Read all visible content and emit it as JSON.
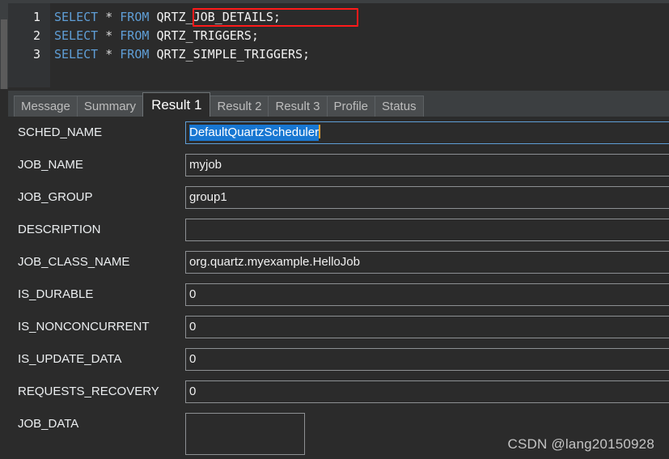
{
  "editor": {
    "lines": [
      {
        "number": "1",
        "keyword_select": "SELECT",
        "star": "*",
        "keyword_from": "FROM",
        "table": "QRTZ_JOB_DETAILS;",
        "highlighted": true
      },
      {
        "number": "2",
        "keyword_select": "SELECT",
        "star": "*",
        "keyword_from": "FROM",
        "table": "QRTZ_TRIGGERS;",
        "highlighted": false
      },
      {
        "number": "3",
        "keyword_select": "SELECT",
        "star": "*",
        "keyword_from": "FROM",
        "table": "QRTZ_SIMPLE_TRIGGERS;",
        "highlighted": false
      }
    ],
    "annotation_color": "#ff1a1a",
    "keyword_color": "#5f9ed6"
  },
  "tabs": [
    {
      "label": "Message",
      "active": false
    },
    {
      "label": "Summary",
      "active": false
    },
    {
      "label": "Result 1",
      "active": true
    },
    {
      "label": "Result 2",
      "active": false
    },
    {
      "label": "Result 3",
      "active": false
    },
    {
      "label": "Profile",
      "active": false
    },
    {
      "label": "Status",
      "active": false
    }
  ],
  "record": {
    "fields": [
      {
        "label": "SCHED_NAME",
        "value": "DefaultQuartzScheduler",
        "selected": true,
        "focused": true,
        "multiline": false
      },
      {
        "label": "JOB_NAME",
        "value": "myjob",
        "selected": false,
        "focused": false,
        "multiline": false
      },
      {
        "label": "JOB_GROUP",
        "value": "group1",
        "selected": false,
        "focused": false,
        "multiline": false
      },
      {
        "label": "DESCRIPTION",
        "value": "",
        "selected": false,
        "focused": false,
        "multiline": false
      },
      {
        "label": "JOB_CLASS_NAME",
        "value": "org.quartz.myexample.HelloJob",
        "selected": false,
        "focused": false,
        "multiline": false
      },
      {
        "label": "IS_DURABLE",
        "value": "0",
        "selected": false,
        "focused": false,
        "multiline": false
      },
      {
        "label": "IS_NONCONCURRENT",
        "value": "0",
        "selected": false,
        "focused": false,
        "multiline": false
      },
      {
        "label": "IS_UPDATE_DATA",
        "value": "0",
        "selected": false,
        "focused": false,
        "multiline": false
      },
      {
        "label": "REQUESTS_RECOVERY",
        "value": "0",
        "selected": false,
        "focused": false,
        "multiline": false
      },
      {
        "label": "JOB_DATA",
        "value": "",
        "selected": false,
        "focused": false,
        "multiline": true
      }
    ]
  },
  "watermark": {
    "text": "CSDN @lang20150928"
  },
  "colors": {
    "background": "#2b2b2b",
    "panel": "#3c3f41",
    "selection": "#1877d2",
    "caret": "#f0a030",
    "border": "#8d9093",
    "accent": "#5f9ed6"
  }
}
